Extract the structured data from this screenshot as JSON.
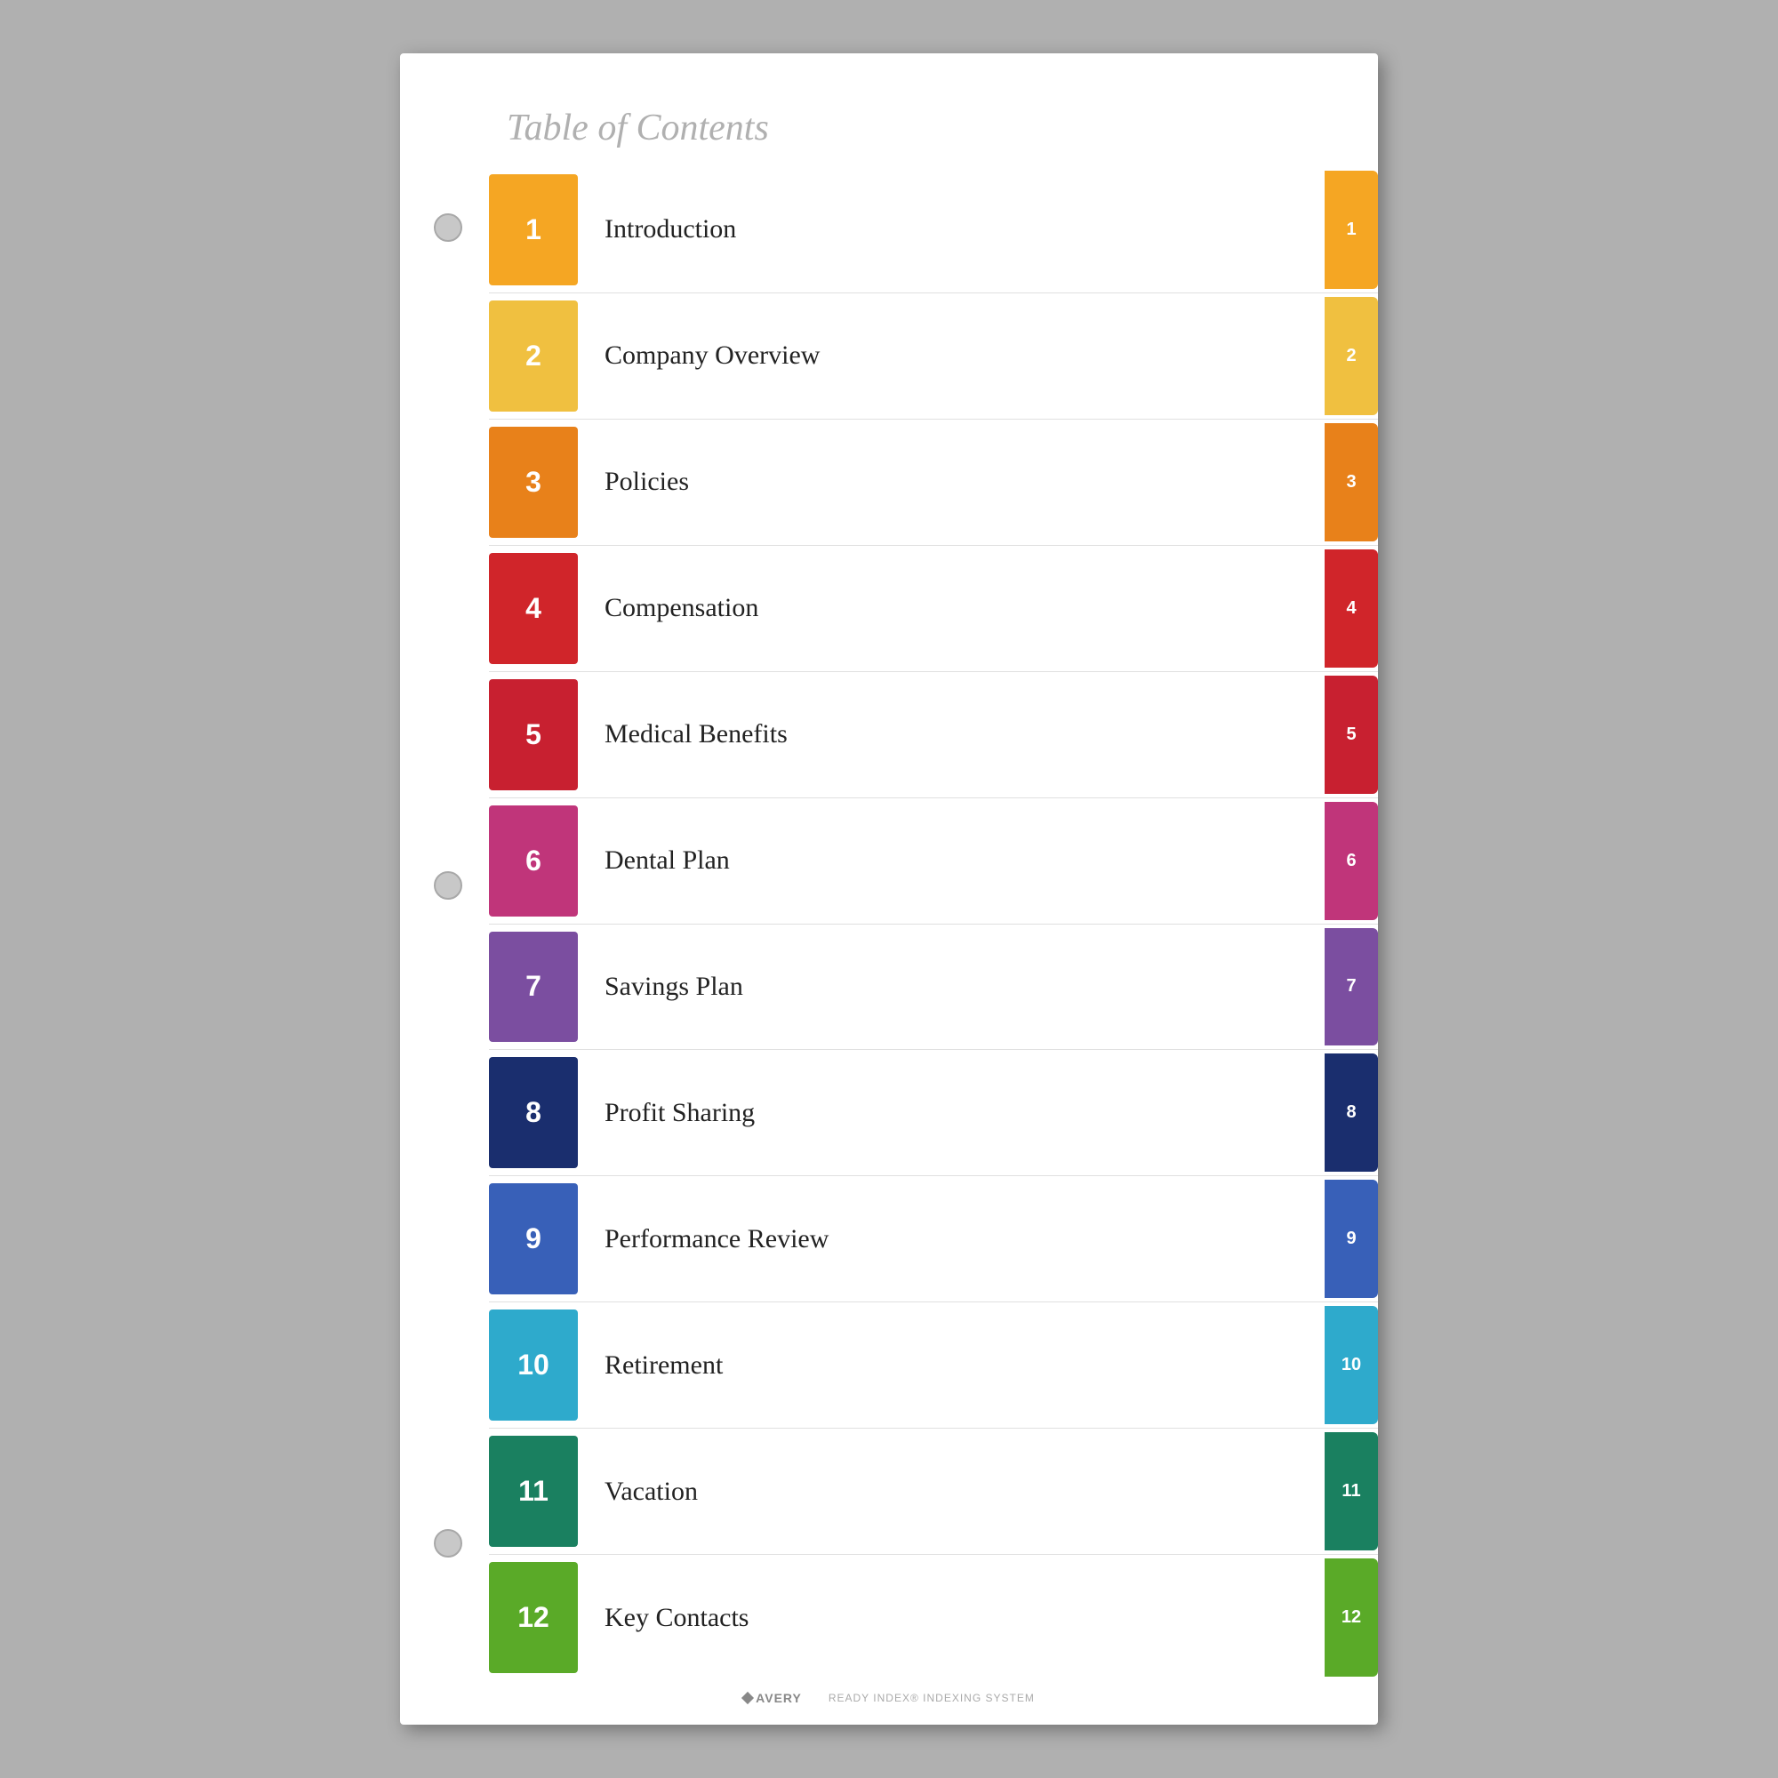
{
  "title": "Table of Contents",
  "footer": {
    "brand": "AVERY",
    "tagline": "READY INDEX® INDEXING SYSTEM"
  },
  "rows": [
    {
      "num": "1",
      "label": "Introduction",
      "color": "#F5A623",
      "tabColor": "#F5A623"
    },
    {
      "num": "2",
      "label": "Company Overview",
      "color": "#F0C040",
      "tabColor": "#F0C040"
    },
    {
      "num": "3",
      "label": "Policies",
      "color": "#E8811A",
      "tabColor": "#E8811A"
    },
    {
      "num": "4",
      "label": "Compensation",
      "color": "#D0252A",
      "tabColor": "#D0252A"
    },
    {
      "num": "5",
      "label": "Medical Benefits",
      "color": "#C82030",
      "tabColor": "#C82030"
    },
    {
      "num": "6",
      "label": "Dental Plan",
      "color": "#C0357A",
      "tabColor": "#C0357A"
    },
    {
      "num": "7",
      "label": "Savings Plan",
      "color": "#7B4EA0",
      "tabColor": "#7B4EA0"
    },
    {
      "num": "8",
      "label": "Profit Sharing",
      "color": "#1A2E6E",
      "tabColor": "#1A2E6E"
    },
    {
      "num": "9",
      "label": "Performance Review",
      "color": "#3860B8",
      "tabColor": "#3860B8"
    },
    {
      "num": "10",
      "label": "Retirement",
      "color": "#2EAACC",
      "tabColor": "#2EAACC"
    },
    {
      "num": "11",
      "label": "Vacation",
      "color": "#1A8060",
      "tabColor": "#1A8060"
    },
    {
      "num": "12",
      "label": "Key Contacts",
      "color": "#5AAA28",
      "tabColor": "#5AAA28"
    }
  ]
}
